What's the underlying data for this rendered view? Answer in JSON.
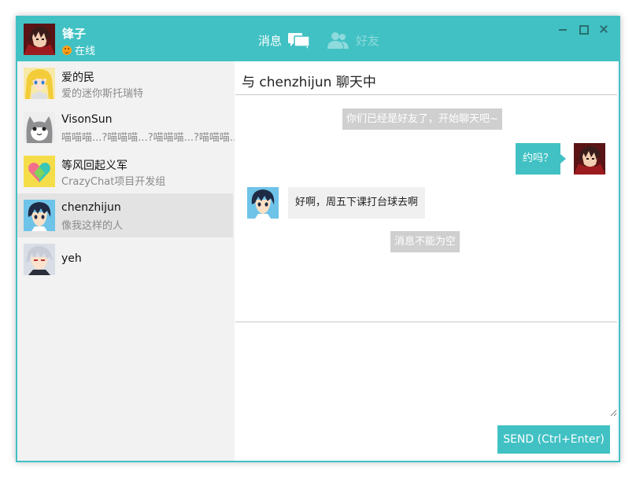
{
  "colors": {
    "accent": "#41c1c3",
    "sidebar_bg": "#f2f2f2",
    "selected_bg": "#e3e3e3",
    "system_msg_bg": "#cfcfcf",
    "incoming_bubble_bg": "#f0f0f0",
    "status_online": "#ffa018"
  },
  "header": {
    "user_name": "锋子",
    "status_icon": "smiley-online-icon",
    "status": "在线",
    "tabs": [
      {
        "label": "消息",
        "icon": "chat-bubbles-icon",
        "active": true
      },
      {
        "label": "好友",
        "icon": "friends-icon",
        "active": false
      }
    ],
    "window_controls": [
      "minimize-icon",
      "maximize-icon",
      "close-icon"
    ]
  },
  "contacts": [
    {
      "name": "爱的民",
      "preview": "爱的迷你斯托瑞特",
      "avatar": "blonde-anime-avatar"
    },
    {
      "name": "VisonSun",
      "preview": "喵喵喵...?喵喵喵...?喵喵喵...?喵喵喵...",
      "avatar": "cat-avatar"
    },
    {
      "name": "等风回起义军",
      "preview": "CrazyChat项目开发组",
      "avatar": "heart-logo-avatar"
    },
    {
      "name": "chenzhijun",
      "preview": "像我这样的人",
      "avatar": "anime-boy-avatar",
      "selected": true
    },
    {
      "name": "yeh",
      "preview": "",
      "avatar": "silver-hair-avatar"
    }
  ],
  "chat": {
    "title": "与 chenzhijun 聊天中",
    "system_messages": [
      "你们已经是好友了，开始聊天吧~",
      "消息不能为空"
    ],
    "outgoing_message": "约吗？",
    "incoming_message": "好啊，周五下课打台球去啊",
    "input_value": "",
    "send_label": "SEND (Ctrl+Enter)"
  }
}
